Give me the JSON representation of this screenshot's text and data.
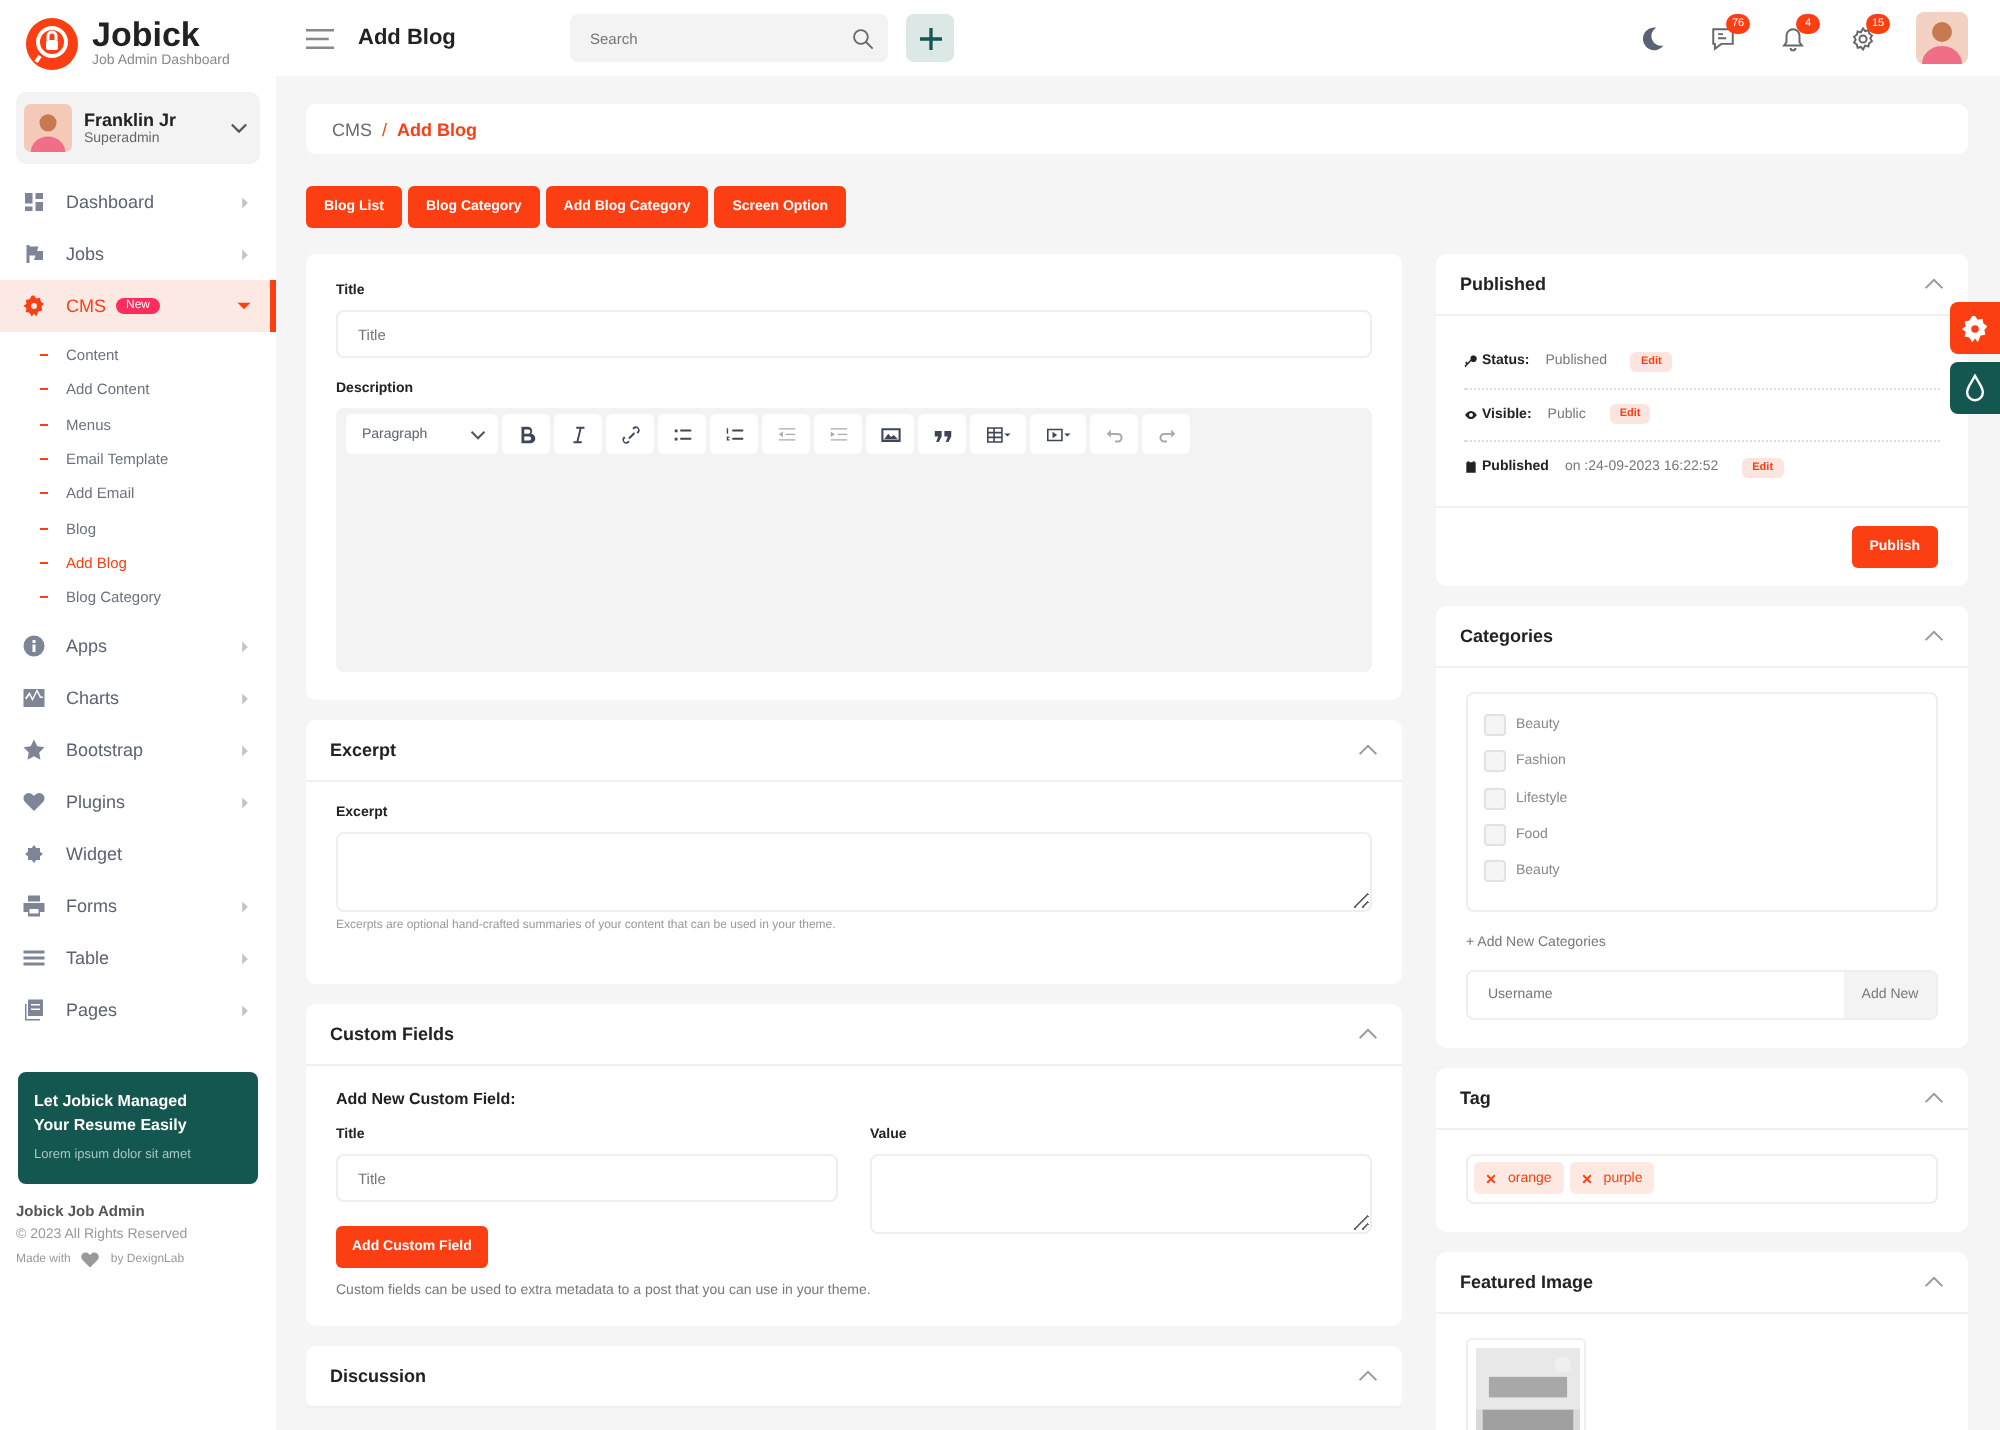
{
  "brand": {
    "name": "Jobick",
    "tagline": "Job Admin Dashboard"
  },
  "user": {
    "name": "Franklin Jr",
    "role": "Superadmin"
  },
  "menu": [
    {
      "label": "Dashboard",
      "kind": "group",
      "selected": false,
      "expanded": false
    },
    {
      "label": "Jobs",
      "kind": "group",
      "selected": false,
      "expanded": false
    },
    {
      "label": "CMS",
      "kind": "group",
      "selected": true,
      "expanded": true,
      "badge": "New",
      "children": [
        {
          "label": "Content",
          "selected": false
        },
        {
          "label": "Add Content",
          "selected": false
        },
        {
          "label": "Menus",
          "selected": false
        },
        {
          "label": "Email Template",
          "selected": false
        },
        {
          "label": "Add Email",
          "selected": false
        },
        {
          "label": "Blog",
          "selected": false
        },
        {
          "label": "Add Blog",
          "selected": true
        },
        {
          "label": "Blog Category",
          "selected": false
        }
      ]
    },
    {
      "label": "Apps",
      "kind": "group",
      "selected": false,
      "expanded": false
    },
    {
      "label": "Charts",
      "kind": "group",
      "selected": false,
      "expanded": false
    },
    {
      "label": "Bootstrap",
      "kind": "group",
      "selected": false,
      "expanded": false
    },
    {
      "label": "Plugins",
      "kind": "group",
      "selected": false,
      "expanded": false
    },
    {
      "label": "Widget",
      "kind": "link",
      "selected": false
    },
    {
      "label": "Forms",
      "kind": "group",
      "selected": false,
      "expanded": false
    },
    {
      "label": "Table",
      "kind": "group",
      "selected": false,
      "expanded": false
    },
    {
      "label": "Pages",
      "kind": "group",
      "selected": false,
      "expanded": false
    }
  ],
  "promo": {
    "title": "Let Jobick Managed Your Resume Easily",
    "text": "Lorem ipsum dolor sit amet"
  },
  "footer": {
    "name": "Jobick Job Admin",
    "copyright": "© 2023 All Rights Reserved",
    "made_with": "Made with",
    "by": "by DexignLab"
  },
  "header": {
    "title": "Add Blog",
    "search": {
      "placeholder": "Search"
    },
    "notifications": [
      {
        "count": "76"
      },
      {
        "count": "4"
      },
      {
        "count": "15"
      }
    ]
  },
  "breadcrumb": {
    "items": [
      "CMS",
      "Add Blog"
    ],
    "separator": "/"
  },
  "actions": [
    "Blog List",
    "Blog Category",
    "Add Blog Category",
    "Screen Option"
  ],
  "post": {
    "title_label": "Title",
    "title_placeholder": "Title",
    "description_label": "Description",
    "format": "Paragraph"
  },
  "excerpt": {
    "heading": "Excerpt",
    "label": "Excerpt",
    "hint": "Excerpts are optional hand-crafted summaries of your content that can be used in your theme."
  },
  "custom_fields": {
    "heading": "Custom Fields",
    "subheading": "Add New Custom Field:",
    "title_label": "Title",
    "title_placeholder": "Title",
    "value_label": "Value",
    "button": "Add Custom Field",
    "hint": "Custom fields can be used to extra metadata to a post that you can use in your theme."
  },
  "discussion": {
    "heading": "Discussion"
  },
  "published": {
    "heading": "Published",
    "rows": [
      {
        "label": "Status:",
        "value": "Published",
        "action": "Edit"
      },
      {
        "label": "Visible:",
        "value": "Public",
        "action": "Edit"
      },
      {
        "label": "Published",
        "value": "on :24-09-2023 16:22:52",
        "action": "Edit"
      }
    ],
    "button": "Publish"
  },
  "categories": {
    "heading": "Categories",
    "items": [
      {
        "label": "Beauty",
        "checked": false
      },
      {
        "label": "Fashion",
        "checked": false
      },
      {
        "label": "Lifestyle",
        "checked": false
      },
      {
        "label": "Food",
        "checked": false
      },
      {
        "label": "Beauty",
        "checked": false
      }
    ],
    "add_link": "+ Add New Categories",
    "input_placeholder": "Username",
    "add_button": "Add New"
  },
  "tag": {
    "heading": "Tag",
    "tags": [
      "orange",
      "purple"
    ]
  },
  "featured": {
    "heading": "Featured Image"
  }
}
